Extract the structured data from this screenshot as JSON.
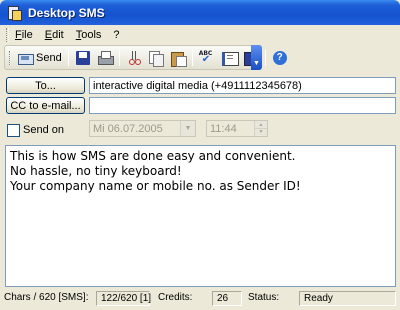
{
  "window": {
    "title": "Desktop SMS"
  },
  "menu": [
    {
      "key": "F",
      "rest": "ile"
    },
    {
      "key": "E",
      "rest": "dit"
    },
    {
      "key": "T",
      "rest": "ools"
    },
    {
      "key": "",
      "rest": "?"
    }
  ],
  "toolbar": {
    "send_label": "Send",
    "icons": [
      "send-icon",
      "save-icon",
      "print-icon",
      "cut-icon",
      "copy-icon",
      "paste-icon",
      "spell-check-icon",
      "address-book-icon",
      "recipients-icon",
      "help-icon"
    ]
  },
  "form": {
    "to_button": "To...",
    "to_value": "interactive digital media (+4911112345678)",
    "cc_button": "CC to e-mail...",
    "cc_value": "",
    "send_on_label": "Send on",
    "date_value": "Mi 06.07.2005",
    "time_value": "11:44"
  },
  "message": {
    "lines": [
      "This is how SMS are done easy and convenient.",
      "No hassle, no tiny keyboard!",
      "Your company name or mobile no. as Sender ID!"
    ]
  },
  "status": {
    "chars_label": "Chars / 620 [SMS]:",
    "chars_value": "122/620 [1]",
    "credits_label": "Credits:",
    "credits_value": "26",
    "status_label": "Status:",
    "status_value": "Ready"
  }
}
